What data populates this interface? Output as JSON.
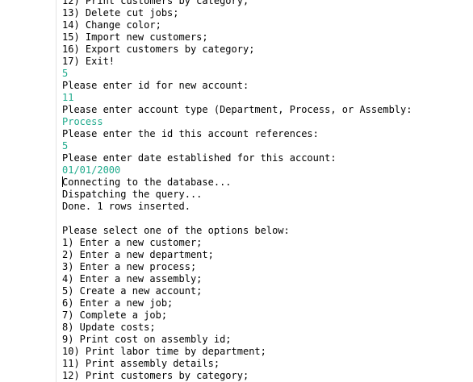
{
  "console": {
    "lines": [
      {
        "text": "12) Print customers by category;",
        "kind": "output"
      },
      {
        "text": "13) Delete cut jobs;",
        "kind": "output"
      },
      {
        "text": "14) Change color;",
        "kind": "output"
      },
      {
        "text": "15) Import new customers;",
        "kind": "output"
      },
      {
        "text": "16) Export customers by category;",
        "kind": "output"
      },
      {
        "text": "17) Exit!",
        "kind": "output"
      },
      {
        "text": "5",
        "kind": "input"
      },
      {
        "text": "Please enter id for new account:",
        "kind": "output"
      },
      {
        "text": "11",
        "kind": "input"
      },
      {
        "text": "Please enter account type (Department, Process, or Assembly:",
        "kind": "output"
      },
      {
        "text": "Process",
        "kind": "input"
      },
      {
        "text": "Please enter the id this account references:",
        "kind": "output"
      },
      {
        "text": "5",
        "kind": "input"
      },
      {
        "text": "Please enter date established for this account:",
        "kind": "output"
      },
      {
        "text": "01/01/2000",
        "kind": "input"
      },
      {
        "text": "Connecting to the database...",
        "kind": "output"
      },
      {
        "text": "Dispatching the query...",
        "kind": "output"
      },
      {
        "text": "Done. 1 rows inserted.",
        "kind": "output"
      },
      {
        "text": "",
        "kind": "blank"
      },
      {
        "text": "Please select one of the options below:",
        "kind": "output"
      },
      {
        "text": "1) Enter a new customer;",
        "kind": "output"
      },
      {
        "text": "2) Enter a new department;",
        "kind": "output"
      },
      {
        "text": "3) Enter a new process;",
        "kind": "output"
      },
      {
        "text": "4) Enter a new assembly;",
        "kind": "output"
      },
      {
        "text": "5) Create a new account;",
        "kind": "output"
      },
      {
        "text": "6) Enter a new job;",
        "kind": "output"
      },
      {
        "text": "7) Complete a job;",
        "kind": "output"
      },
      {
        "text": "8) Update costs;",
        "kind": "output"
      },
      {
        "text": "9) Print cost on assembly id;",
        "kind": "output"
      },
      {
        "text": "10) Print labor time by department;",
        "kind": "output"
      },
      {
        "text": "11) Print assembly details;",
        "kind": "output"
      },
      {
        "text": "12) Print customers by category;",
        "kind": "output"
      }
    ],
    "caret_line": 15
  },
  "colors": {
    "output_text": "#000000",
    "input_text": "#1faa8c",
    "background": "#ffffff",
    "gutter_border": "#e4e4e4"
  }
}
